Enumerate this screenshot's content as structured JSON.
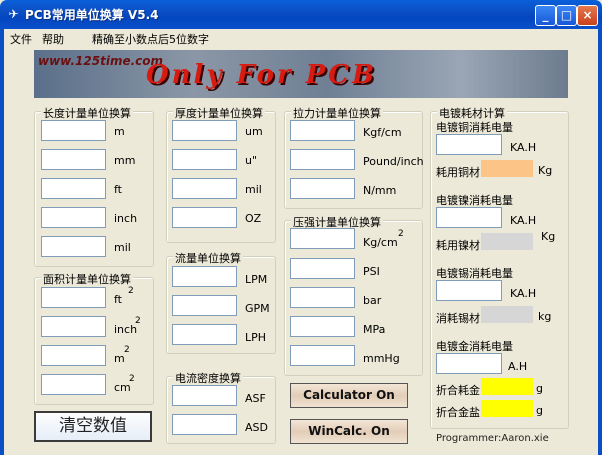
{
  "window": {
    "title": "PCB常用单位换算 V5.4",
    "title_icon": "app-icon",
    "controls": {
      "minimize": "_",
      "maximize": "□",
      "close": "×"
    }
  },
  "menu": {
    "file": "文件",
    "help": "帮助",
    "precision_note": "精确至小数点后5位数字"
  },
  "banner": {
    "url": "www.125time.com",
    "slogan": "Only For PCB"
  },
  "length": {
    "title": "长度计量单位换算",
    "units": [
      "m",
      "mm",
      "ft",
      "inch",
      "mil"
    ],
    "values": [
      "",
      "",
      "",
      "",
      ""
    ]
  },
  "area": {
    "title": "面积计量单位换算",
    "units": [
      "ft",
      "inch",
      "m",
      "cm"
    ],
    "superscripts": [
      "2",
      "2",
      "2",
      "2"
    ],
    "values": [
      "",
      "",
      "",
      ""
    ]
  },
  "thickness": {
    "title": "厚度计量单位换算",
    "units": [
      "um",
      "u\"",
      "mil",
      "OZ"
    ],
    "values": [
      "",
      "",
      "",
      ""
    ]
  },
  "flow": {
    "title": "流量单位换算",
    "units": [
      "LPM",
      "GPM",
      "LPH"
    ],
    "values": [
      "",
      "",
      ""
    ]
  },
  "current_density": {
    "title": "电流密度换算",
    "units": [
      "ASF",
      "ASD"
    ],
    "values": [
      "",
      ""
    ]
  },
  "tension": {
    "title": "拉力计量单位换算",
    "units": [
      "Kgf/cm",
      "Pound/inch",
      "N/mm"
    ],
    "values": [
      "",
      "",
      ""
    ]
  },
  "pressure": {
    "title": "压强计量单位换算",
    "units": [
      "Kg/cm",
      "PSI",
      "bar",
      "MPa",
      "mmHg"
    ],
    "kg_superscript": "2",
    "values": [
      "",
      "",
      "",
      "",
      ""
    ]
  },
  "plating": {
    "title": "电镀耗材计算",
    "copper_label": "电镀铜消耗电量",
    "copper_unit": "KA.H",
    "copper_material_label": "耗用铜材",
    "copper_material_unit": "Kg",
    "nickel_label": "电镀镍消耗电量",
    "nickel_unit": "KA.H",
    "nickel_material_label": "耗用镍材",
    "nickel_material_unit": "Kg",
    "tin_label": "电镀锡消耗电量",
    "tin_unit": "KA.H",
    "tin_material_label": "消耗锡材",
    "tin_material_unit": "kg",
    "gold_label": "电镀金消耗电量",
    "gold_unit": "A.H",
    "gold_combined_label": "折合耗金",
    "gold_combined_unit": "g",
    "gold_salt_label": "折合金盐",
    "gold_salt_unit": "g",
    "colors": {
      "copper": "#fcc486",
      "nickel": "#d6d6d6",
      "tin": "#d6d6d6",
      "gold": "#ffff00"
    }
  },
  "buttons": {
    "clear": "清空数值",
    "calculator": "Calculator On",
    "wincalc": "WinCalc. On"
  },
  "programmer": "Programmer:Aaron.xie"
}
